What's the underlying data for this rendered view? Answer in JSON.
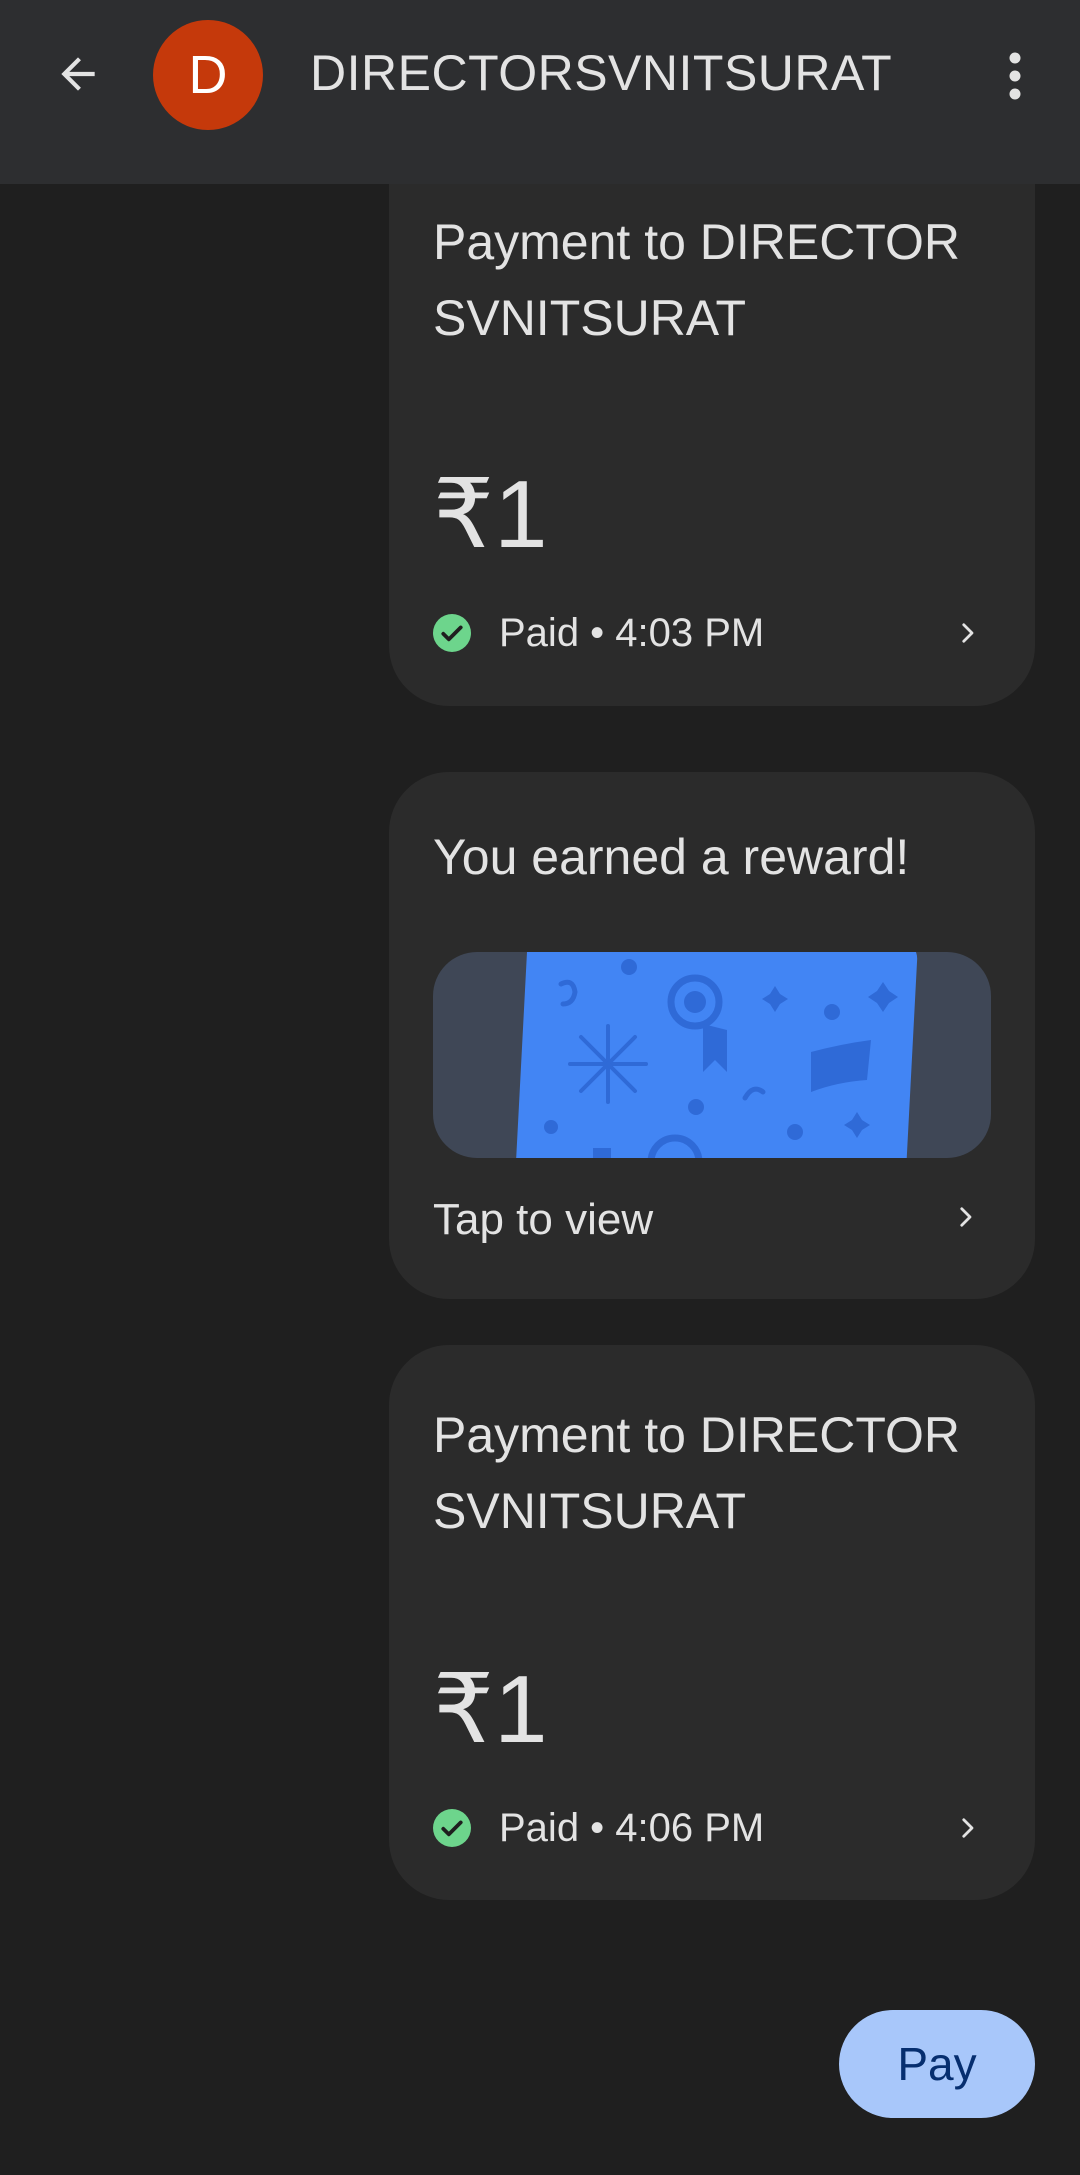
{
  "header": {
    "contact_name": "DIRECTORSVNITSURAT",
    "avatar_initial": "D",
    "avatar_color": "#c5390b"
  },
  "messages": [
    {
      "type": "payment",
      "title": "Payment to DIRECTORSVNITSURAT",
      "amount": "₹1",
      "status": "Paid • 4:03 PM"
    },
    {
      "type": "reward",
      "title": "You earned a reward!",
      "action": "Tap to view"
    },
    {
      "type": "payment",
      "title": "Payment to DIRECTORSVNITSURAT",
      "amount": "₹1",
      "status": "Paid • 4:06 PM"
    }
  ],
  "pay_button": {
    "label": "Pay"
  },
  "colors": {
    "background": "#1f1f1f",
    "header": "#2d2e30",
    "card": "#2b2b2b",
    "paid_green": "#6dd58c",
    "reward_card_blue": "#4285f4",
    "pay_button": "#a8c7fa"
  },
  "icons": [
    "back-arrow-icon",
    "more-vert-icon",
    "check-circle-icon",
    "chevron-right-icon",
    "reward-card-icon"
  ]
}
